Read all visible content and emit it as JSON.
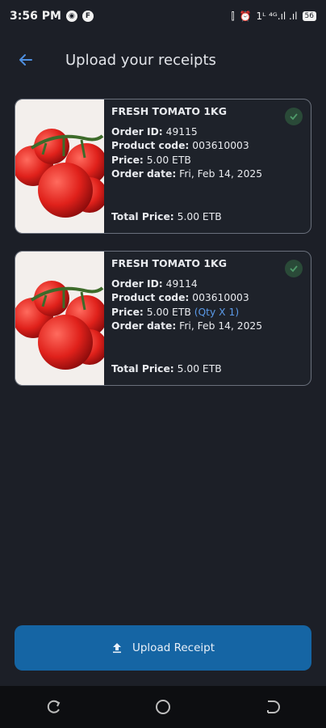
{
  "status_bar": {
    "time": "3:56 PM",
    "right_text": "1ᴸ ⁴ᴳ.ıl .ıl",
    "battery": "56"
  },
  "header": {
    "title": "Upload your receipts",
    "back_icon": "arrow-left-icon"
  },
  "receipts": [
    {
      "product_name": "FRESH TOMATO 1KG",
      "order_id_label": "Order ID:",
      "order_id": "49115",
      "product_code_label": "Product code:",
      "product_code": "003610003",
      "price_label": "Price:",
      "price": "5.00 ETB",
      "qty": "",
      "order_date_label": "Order date:",
      "order_date": "Fri, Feb 14, 2025",
      "total_label": "Total Price:",
      "total": "5.00 ETB"
    },
    {
      "product_name": "FRESH TOMATO 1KG",
      "order_id_label": "Order ID:",
      "order_id": "49114",
      "product_code_label": "Product code:",
      "product_code": "003610003",
      "price_label": "Price:",
      "price": "5.00 ETB",
      "qty": "(Qty X 1)",
      "order_date_label": "Order date:",
      "order_date": "Fri, Feb 14, 2025",
      "total_label": "Total Price:",
      "total": "5.00 ETB"
    }
  ],
  "upload_button": {
    "label": "Upload Receipt",
    "icon": "upload-icon"
  },
  "colors": {
    "background": "#1c1f27",
    "accent": "#1565a4",
    "link": "#5b9ae8",
    "check": "#3f8f5c"
  }
}
